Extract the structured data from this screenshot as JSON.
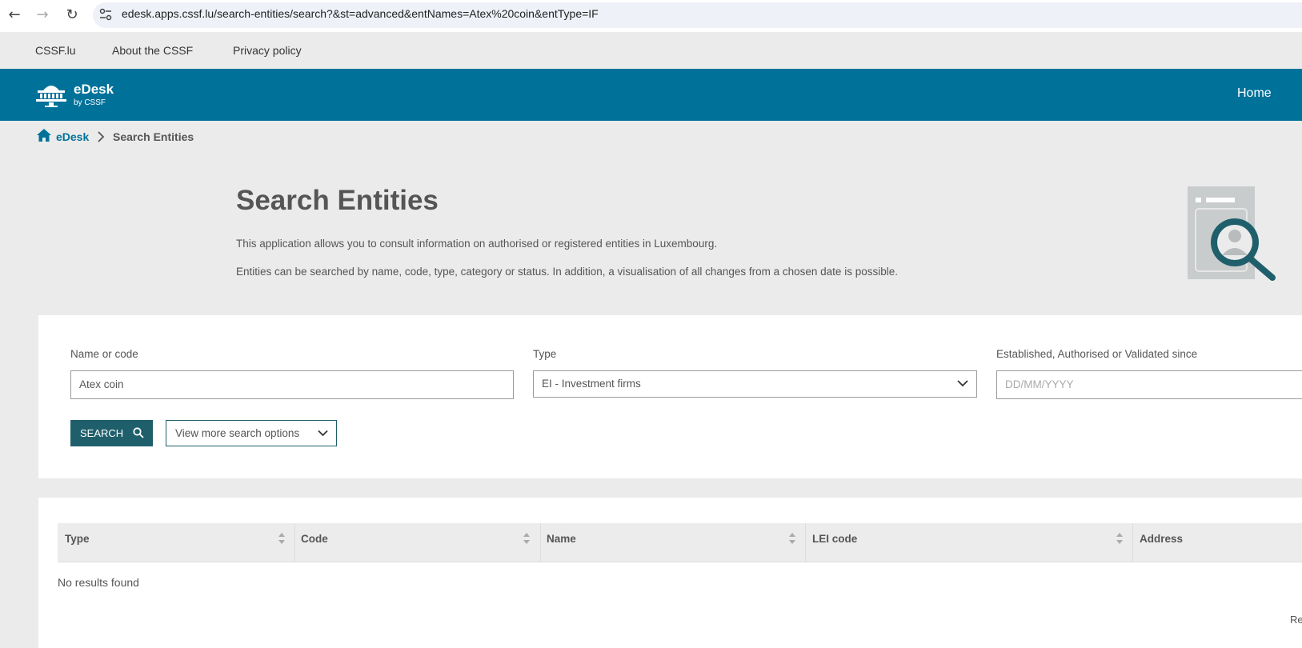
{
  "browser": {
    "url": "edesk.apps.cssf.lu/search-entities/search?&st=advanced&entNames=Atex%20coin&entType=IF"
  },
  "top_links": [
    "CSSF.lu",
    "About the CSSF",
    "Privacy policy"
  ],
  "header": {
    "logo_title": "eDesk",
    "logo_sub": "by CSSF",
    "home": "Home"
  },
  "breadcrumb": {
    "root": "eDesk",
    "current": "Search Entities"
  },
  "intro": {
    "title": "Search Entities",
    "para1": "This application allows you to consult information on authorised or registered entities in Luxembourg.",
    "para2": "Entities can be searched by name, code, type, category or status. In addition, a visualisation of all changes from a chosen date is possible."
  },
  "search": {
    "name_label": "Name or code",
    "name_value": "Atex coin",
    "type_label": "Type",
    "type_value": "EI - Investment firms",
    "date_label": "Established, Authorised or Validated since",
    "date_placeholder": "DD/MM/YYYY",
    "search_button": "SEARCH",
    "more_options": "View more search options"
  },
  "results": {
    "columns": [
      "Type",
      "Code",
      "Name",
      "LEI code",
      "Address"
    ],
    "empty_text": "No results found",
    "footer_partial": "Re"
  },
  "colors": {
    "brand": "#00729a",
    "button": "#1f5f6b",
    "icon_teal": "#1f5f6b"
  }
}
